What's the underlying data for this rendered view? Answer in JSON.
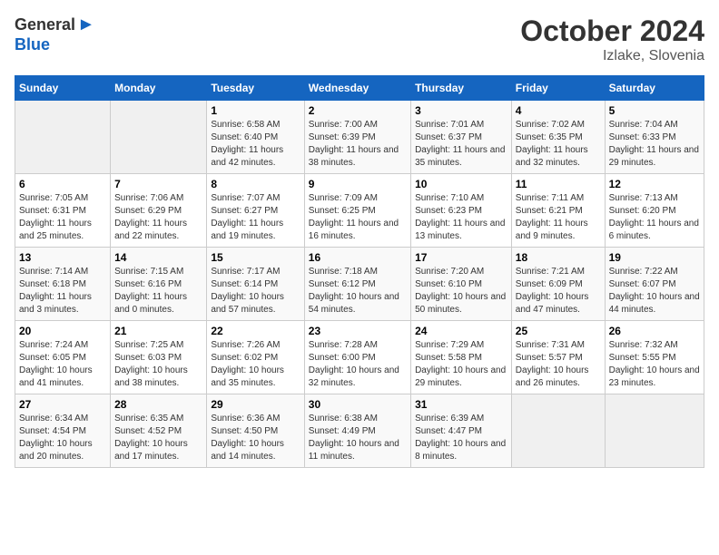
{
  "logo": {
    "general": "General",
    "blue": "Blue"
  },
  "title": "October 2024",
  "subtitle": "Izlake, Slovenia",
  "days_header": [
    "Sunday",
    "Monday",
    "Tuesday",
    "Wednesday",
    "Thursday",
    "Friday",
    "Saturday"
  ],
  "weeks": [
    [
      {
        "day": "",
        "sunrise": "",
        "sunset": "",
        "daylight": ""
      },
      {
        "day": "",
        "sunrise": "",
        "sunset": "",
        "daylight": ""
      },
      {
        "day": "1",
        "sunrise": "Sunrise: 6:58 AM",
        "sunset": "Sunset: 6:40 PM",
        "daylight": "Daylight: 11 hours and 42 minutes."
      },
      {
        "day": "2",
        "sunrise": "Sunrise: 7:00 AM",
        "sunset": "Sunset: 6:39 PM",
        "daylight": "Daylight: 11 hours and 38 minutes."
      },
      {
        "day": "3",
        "sunrise": "Sunrise: 7:01 AM",
        "sunset": "Sunset: 6:37 PM",
        "daylight": "Daylight: 11 hours and 35 minutes."
      },
      {
        "day": "4",
        "sunrise": "Sunrise: 7:02 AM",
        "sunset": "Sunset: 6:35 PM",
        "daylight": "Daylight: 11 hours and 32 minutes."
      },
      {
        "day": "5",
        "sunrise": "Sunrise: 7:04 AM",
        "sunset": "Sunset: 6:33 PM",
        "daylight": "Daylight: 11 hours and 29 minutes."
      }
    ],
    [
      {
        "day": "6",
        "sunrise": "Sunrise: 7:05 AM",
        "sunset": "Sunset: 6:31 PM",
        "daylight": "Daylight: 11 hours and 25 minutes."
      },
      {
        "day": "7",
        "sunrise": "Sunrise: 7:06 AM",
        "sunset": "Sunset: 6:29 PM",
        "daylight": "Daylight: 11 hours and 22 minutes."
      },
      {
        "day": "8",
        "sunrise": "Sunrise: 7:07 AM",
        "sunset": "Sunset: 6:27 PM",
        "daylight": "Daylight: 11 hours and 19 minutes."
      },
      {
        "day": "9",
        "sunrise": "Sunrise: 7:09 AM",
        "sunset": "Sunset: 6:25 PM",
        "daylight": "Daylight: 11 hours and 16 minutes."
      },
      {
        "day": "10",
        "sunrise": "Sunrise: 7:10 AM",
        "sunset": "Sunset: 6:23 PM",
        "daylight": "Daylight: 11 hours and 13 minutes."
      },
      {
        "day": "11",
        "sunrise": "Sunrise: 7:11 AM",
        "sunset": "Sunset: 6:21 PM",
        "daylight": "Daylight: 11 hours and 9 minutes."
      },
      {
        "day": "12",
        "sunrise": "Sunrise: 7:13 AM",
        "sunset": "Sunset: 6:20 PM",
        "daylight": "Daylight: 11 hours and 6 minutes."
      }
    ],
    [
      {
        "day": "13",
        "sunrise": "Sunrise: 7:14 AM",
        "sunset": "Sunset: 6:18 PM",
        "daylight": "Daylight: 11 hours and 3 minutes."
      },
      {
        "day": "14",
        "sunrise": "Sunrise: 7:15 AM",
        "sunset": "Sunset: 6:16 PM",
        "daylight": "Daylight: 11 hours and 0 minutes."
      },
      {
        "day": "15",
        "sunrise": "Sunrise: 7:17 AM",
        "sunset": "Sunset: 6:14 PM",
        "daylight": "Daylight: 10 hours and 57 minutes."
      },
      {
        "day": "16",
        "sunrise": "Sunrise: 7:18 AM",
        "sunset": "Sunset: 6:12 PM",
        "daylight": "Daylight: 10 hours and 54 minutes."
      },
      {
        "day": "17",
        "sunrise": "Sunrise: 7:20 AM",
        "sunset": "Sunset: 6:10 PM",
        "daylight": "Daylight: 10 hours and 50 minutes."
      },
      {
        "day": "18",
        "sunrise": "Sunrise: 7:21 AM",
        "sunset": "Sunset: 6:09 PM",
        "daylight": "Daylight: 10 hours and 47 minutes."
      },
      {
        "day": "19",
        "sunrise": "Sunrise: 7:22 AM",
        "sunset": "Sunset: 6:07 PM",
        "daylight": "Daylight: 10 hours and 44 minutes."
      }
    ],
    [
      {
        "day": "20",
        "sunrise": "Sunrise: 7:24 AM",
        "sunset": "Sunset: 6:05 PM",
        "daylight": "Daylight: 10 hours and 41 minutes."
      },
      {
        "day": "21",
        "sunrise": "Sunrise: 7:25 AM",
        "sunset": "Sunset: 6:03 PM",
        "daylight": "Daylight: 10 hours and 38 minutes."
      },
      {
        "day": "22",
        "sunrise": "Sunrise: 7:26 AM",
        "sunset": "Sunset: 6:02 PM",
        "daylight": "Daylight: 10 hours and 35 minutes."
      },
      {
        "day": "23",
        "sunrise": "Sunrise: 7:28 AM",
        "sunset": "Sunset: 6:00 PM",
        "daylight": "Daylight: 10 hours and 32 minutes."
      },
      {
        "day": "24",
        "sunrise": "Sunrise: 7:29 AM",
        "sunset": "Sunset: 5:58 PM",
        "daylight": "Daylight: 10 hours and 29 minutes."
      },
      {
        "day": "25",
        "sunrise": "Sunrise: 7:31 AM",
        "sunset": "Sunset: 5:57 PM",
        "daylight": "Daylight: 10 hours and 26 minutes."
      },
      {
        "day": "26",
        "sunrise": "Sunrise: 7:32 AM",
        "sunset": "Sunset: 5:55 PM",
        "daylight": "Daylight: 10 hours and 23 minutes."
      }
    ],
    [
      {
        "day": "27",
        "sunrise": "Sunrise: 6:34 AM",
        "sunset": "Sunset: 4:54 PM",
        "daylight": "Daylight: 10 hours and 20 minutes."
      },
      {
        "day": "28",
        "sunrise": "Sunrise: 6:35 AM",
        "sunset": "Sunset: 4:52 PM",
        "daylight": "Daylight: 10 hours and 17 minutes."
      },
      {
        "day": "29",
        "sunrise": "Sunrise: 6:36 AM",
        "sunset": "Sunset: 4:50 PM",
        "daylight": "Daylight: 10 hours and 14 minutes."
      },
      {
        "day": "30",
        "sunrise": "Sunrise: 6:38 AM",
        "sunset": "Sunset: 4:49 PM",
        "daylight": "Daylight: 10 hours and 11 minutes."
      },
      {
        "day": "31",
        "sunrise": "Sunrise: 6:39 AM",
        "sunset": "Sunset: 4:47 PM",
        "daylight": "Daylight: 10 hours and 8 minutes."
      },
      {
        "day": "",
        "sunrise": "",
        "sunset": "",
        "daylight": ""
      },
      {
        "day": "",
        "sunrise": "",
        "sunset": "",
        "daylight": ""
      }
    ]
  ]
}
